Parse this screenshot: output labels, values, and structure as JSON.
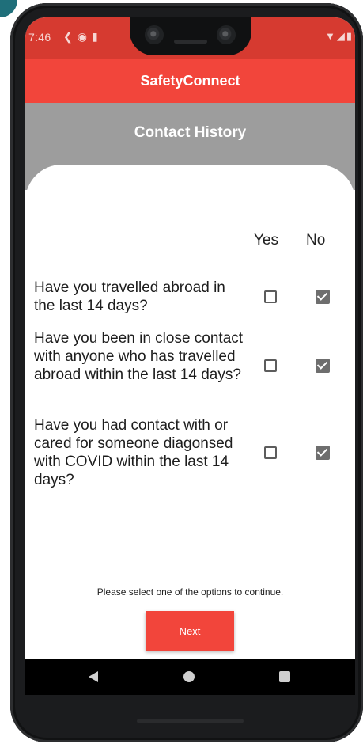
{
  "status": {
    "time": "7:46",
    "left_icons": [
      "directions-icon",
      "app-icon",
      "sim-icon"
    ],
    "right_icons": [
      "wifi-icon",
      "signal-icon",
      "battery-icon"
    ]
  },
  "app": {
    "title": "SafetyConnect"
  },
  "header": {
    "title": "Contact History"
  },
  "columns": {
    "yes": "Yes",
    "no": "No"
  },
  "questions": [
    {
      "text": "Have you travelled abroad in the last 14 days?",
      "yes": false,
      "no": true
    },
    {
      "text": "Have you been in close contact with anyone who has travelled abroad within the last 14 days?",
      "yes": false,
      "no": true
    },
    {
      "text": "Have you had contact with or cared for someone diagonsed with COVID within the last 14 days?",
      "yes": false,
      "no": true
    }
  ],
  "prompt": "Please select one of the options to continue.",
  "next_button": {
    "label": "Next"
  },
  "colors": {
    "status_bar": "#d63a30",
    "app_bar": "#f2453b",
    "header_band": "#9d9d9d",
    "checkbox_checked": "#6e6e6e"
  },
  "nav": {
    "icons": [
      "back-icon",
      "home-icon",
      "recents-icon"
    ]
  }
}
